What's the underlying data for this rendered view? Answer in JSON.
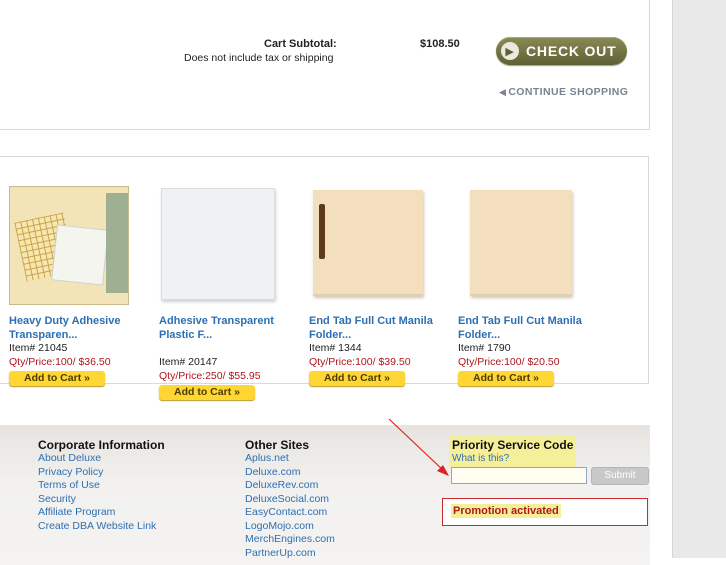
{
  "cart": {
    "subtotal_label": "Cart Subtotal:",
    "subtotal_note": "Does not include tax or shipping",
    "subtotal_value": "$108.50",
    "checkout_label": "CHECK OUT",
    "continue_label": "CONTINUE SHOPPING"
  },
  "products": [
    {
      "name": "Heavy Duty Adhesive Transparen...",
      "item": "Item# 21045",
      "qty_price": "Qty/Price:100/ $36.50",
      "add_label": "Add to Cart »"
    },
    {
      "name": "Adhesive Transparent Plastic F...",
      "item": "Item# 20147",
      "qty_price": "Qty/Price:250/ $55.95",
      "add_label": "Add to Cart »"
    },
    {
      "name": "End Tab Full Cut Manila Folder...",
      "item": "Item# 1344",
      "qty_price": "Qty/Price:100/ $39.50",
      "add_label": "Add to Cart »"
    },
    {
      "name": "End Tab Full Cut Manila Folder...",
      "item": "Item# 1790",
      "qty_price": "Qty/Price:100/ $20.50",
      "add_label": "Add to Cart »"
    }
  ],
  "footer": {
    "corporate": {
      "title": "Corporate Information",
      "links": [
        "About Deluxe",
        "Privacy Policy",
        "Terms of Use",
        "Security",
        "Affiliate Program",
        "Create DBA Website Link"
      ]
    },
    "other_sites": {
      "title": "Other Sites",
      "links": [
        "Aplus.net",
        "Deluxe.com",
        "DeluxeRev.com",
        "DeluxeSocial.com",
        "EasyContact.com",
        "LogoMojo.com",
        "MerchEngines.com",
        "PartnerUp.com"
      ]
    },
    "priority": {
      "title": "Priority Service Code",
      "help_link": "What is this?",
      "input_value": "",
      "submit_label": "Submit",
      "promo_message": "Promotion activated"
    }
  },
  "colors": {
    "link": "#2d6fb0",
    "price_red": "#b0161c",
    "add_to_cart": "#ffd633",
    "checkout": "#6f7042",
    "highlight": "#f6ef9a",
    "annotation": "#e02020"
  }
}
